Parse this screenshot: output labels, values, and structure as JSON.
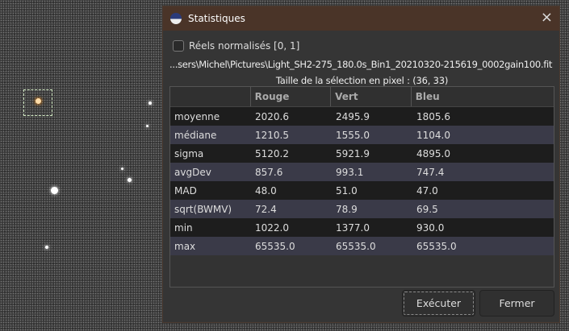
{
  "dialog": {
    "title": "Statistiques",
    "close_icon": "×"
  },
  "checkbox": {
    "label": "Réels normalisés [0, 1]",
    "checked": false
  },
  "file_path": "...sers\\Michel\\Pictures\\Light_SH2-275_180.0s_Bin1_20210320-215619_0002gain100.fit",
  "selection_size": "Taille de la sélection en pixel : (36, 33)",
  "table": {
    "headers": [
      "",
      "Rouge",
      "Vert",
      "Bleu"
    ],
    "rows": [
      [
        "moyenne",
        "2020.6",
        "2495.9",
        "1805.6"
      ],
      [
        "médiane",
        "1210.5",
        "1555.0",
        "1104.0"
      ],
      [
        "sigma",
        "5120.2",
        "5921.9",
        "4895.0"
      ],
      [
        "avgDev",
        "857.6",
        "993.1",
        "747.4"
      ],
      [
        "MAD",
        "48.0",
        "51.0",
        "47.0"
      ],
      [
        "sqrt(BWMV)",
        "72.4",
        "78.9",
        "69.5"
      ],
      [
        "min",
        "1022.0",
        "1377.0",
        "930.0"
      ],
      [
        "max",
        "65535.0",
        "65535.0",
        "65535.0"
      ]
    ]
  },
  "buttons": {
    "execute": "Exécuter",
    "close": "Fermer"
  }
}
